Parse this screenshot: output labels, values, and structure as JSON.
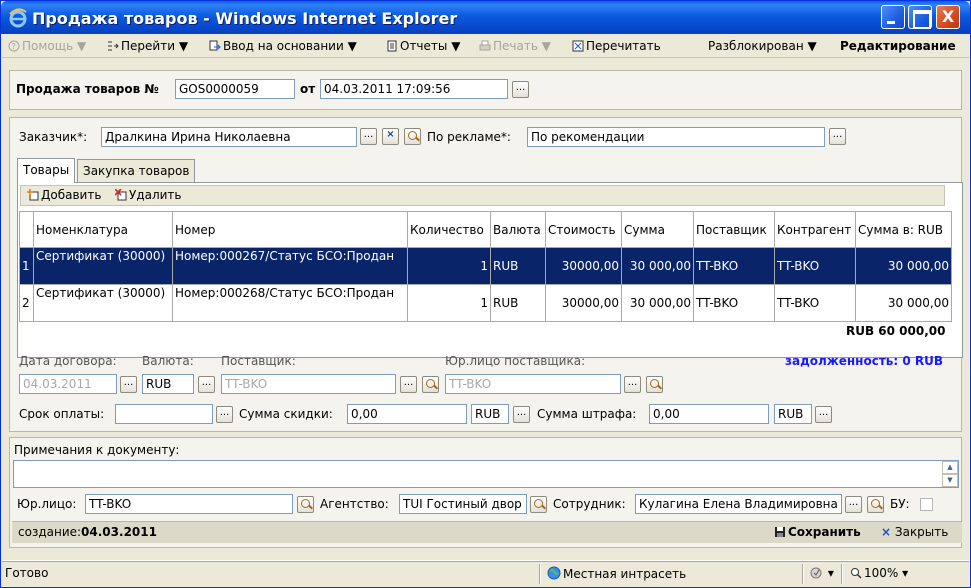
{
  "window": {
    "title": "Продажа товаров - Windows Internet Explorer",
    "close_glyph": "X"
  },
  "toolbar": {
    "help": "Помощь",
    "goto": "Перейти",
    "input_based": "Ввод на основании",
    "reports": "Отчеты",
    "print": "Печать",
    "reread": "Перечитать",
    "lock_state": "Разблокирован",
    "mode": "Редактирование"
  },
  "doc": {
    "title_label": "Продажа товаров №",
    "number": "GOS0000059",
    "from_label": "от",
    "date": "04.03.2011 17:09:56"
  },
  "customer": {
    "label": "Заказчик*:",
    "value": "Дралкина Ирина Николаевна",
    "ad_label": "По рекламе*:",
    "ad_value": "По рекомендации"
  },
  "tabs": [
    {
      "label": "Товары"
    },
    {
      "label": "Закупка товаров"
    }
  ],
  "grid_toolbar": {
    "add": "Добавить",
    "delete": "Удалить"
  },
  "grid": {
    "columns": [
      "Номенклатура",
      "Номер",
      "Количество",
      "Валюта",
      "Стоимость",
      "Сумма",
      "Поставщик",
      "Контрагент",
      "Сумма в: RUB"
    ],
    "rows": [
      {
        "n": "1",
        "nomenclature": "Сертификат (30000)",
        "number": "Номер:000267/Статус БСО:Продан",
        "qty": "1",
        "currency": "RUB",
        "cost": "30000,00",
        "sum": "30 000,00",
        "supplier": "TT-BKO",
        "counterparty": "TT-BKO",
        "sum_rub": "30 000,00"
      },
      {
        "n": "2",
        "nomenclature": "Сертификат (30000)",
        "number": "Номер:000268/Статус БСО:Продан",
        "qty": "1",
        "currency": "RUB",
        "cost": "30000,00",
        "sum": "30 000,00",
        "supplier": "TT-BKO",
        "counterparty": "TT-BKO",
        "sum_rub": "30 000,00"
      }
    ],
    "total": "RUB 60 000,00"
  },
  "contract": {
    "date_label": "Дата договора:",
    "date_value": "04.03.2011",
    "currency_label": "Валюта:",
    "currency_value": "RUB",
    "supplier_label": "Поставщик:",
    "supplier_value": "TT-BKO",
    "legal_label": "Юр.лицо поставщика:",
    "legal_value": "TT-BKO",
    "debt": "задолженность: 0 RUB"
  },
  "payment": {
    "term_label": "Срок оплаты:",
    "term_value": "",
    "discount_label": "Сумма скидки:",
    "discount_value": "0,00",
    "discount_cur": "RUB",
    "fine_label": "Сумма штрафа:",
    "fine_value": "0,00",
    "fine_cur": "RUB"
  },
  "notes": {
    "label": "Примечания к документу:",
    "value": ""
  },
  "bottom": {
    "legal_label": "Юр.лицо:",
    "legal_value": "TT-BKO",
    "agency_label": "Агентство:",
    "agency_value": "TUI Гостиный двор",
    "employee_label": "Сотрудник:",
    "employee_value": "Кулагина Елена Владимировна",
    "bu_label": "БУ:",
    "created_label": "создание:",
    "created_value": "04.03.2011",
    "save": "Сохранить",
    "close": "Закрыть"
  },
  "status": {
    "text": "Готово",
    "zone": "Местная интрасеть",
    "zoom": "100%"
  },
  "ellipsis": "...",
  "clear_glyph": "×"
}
